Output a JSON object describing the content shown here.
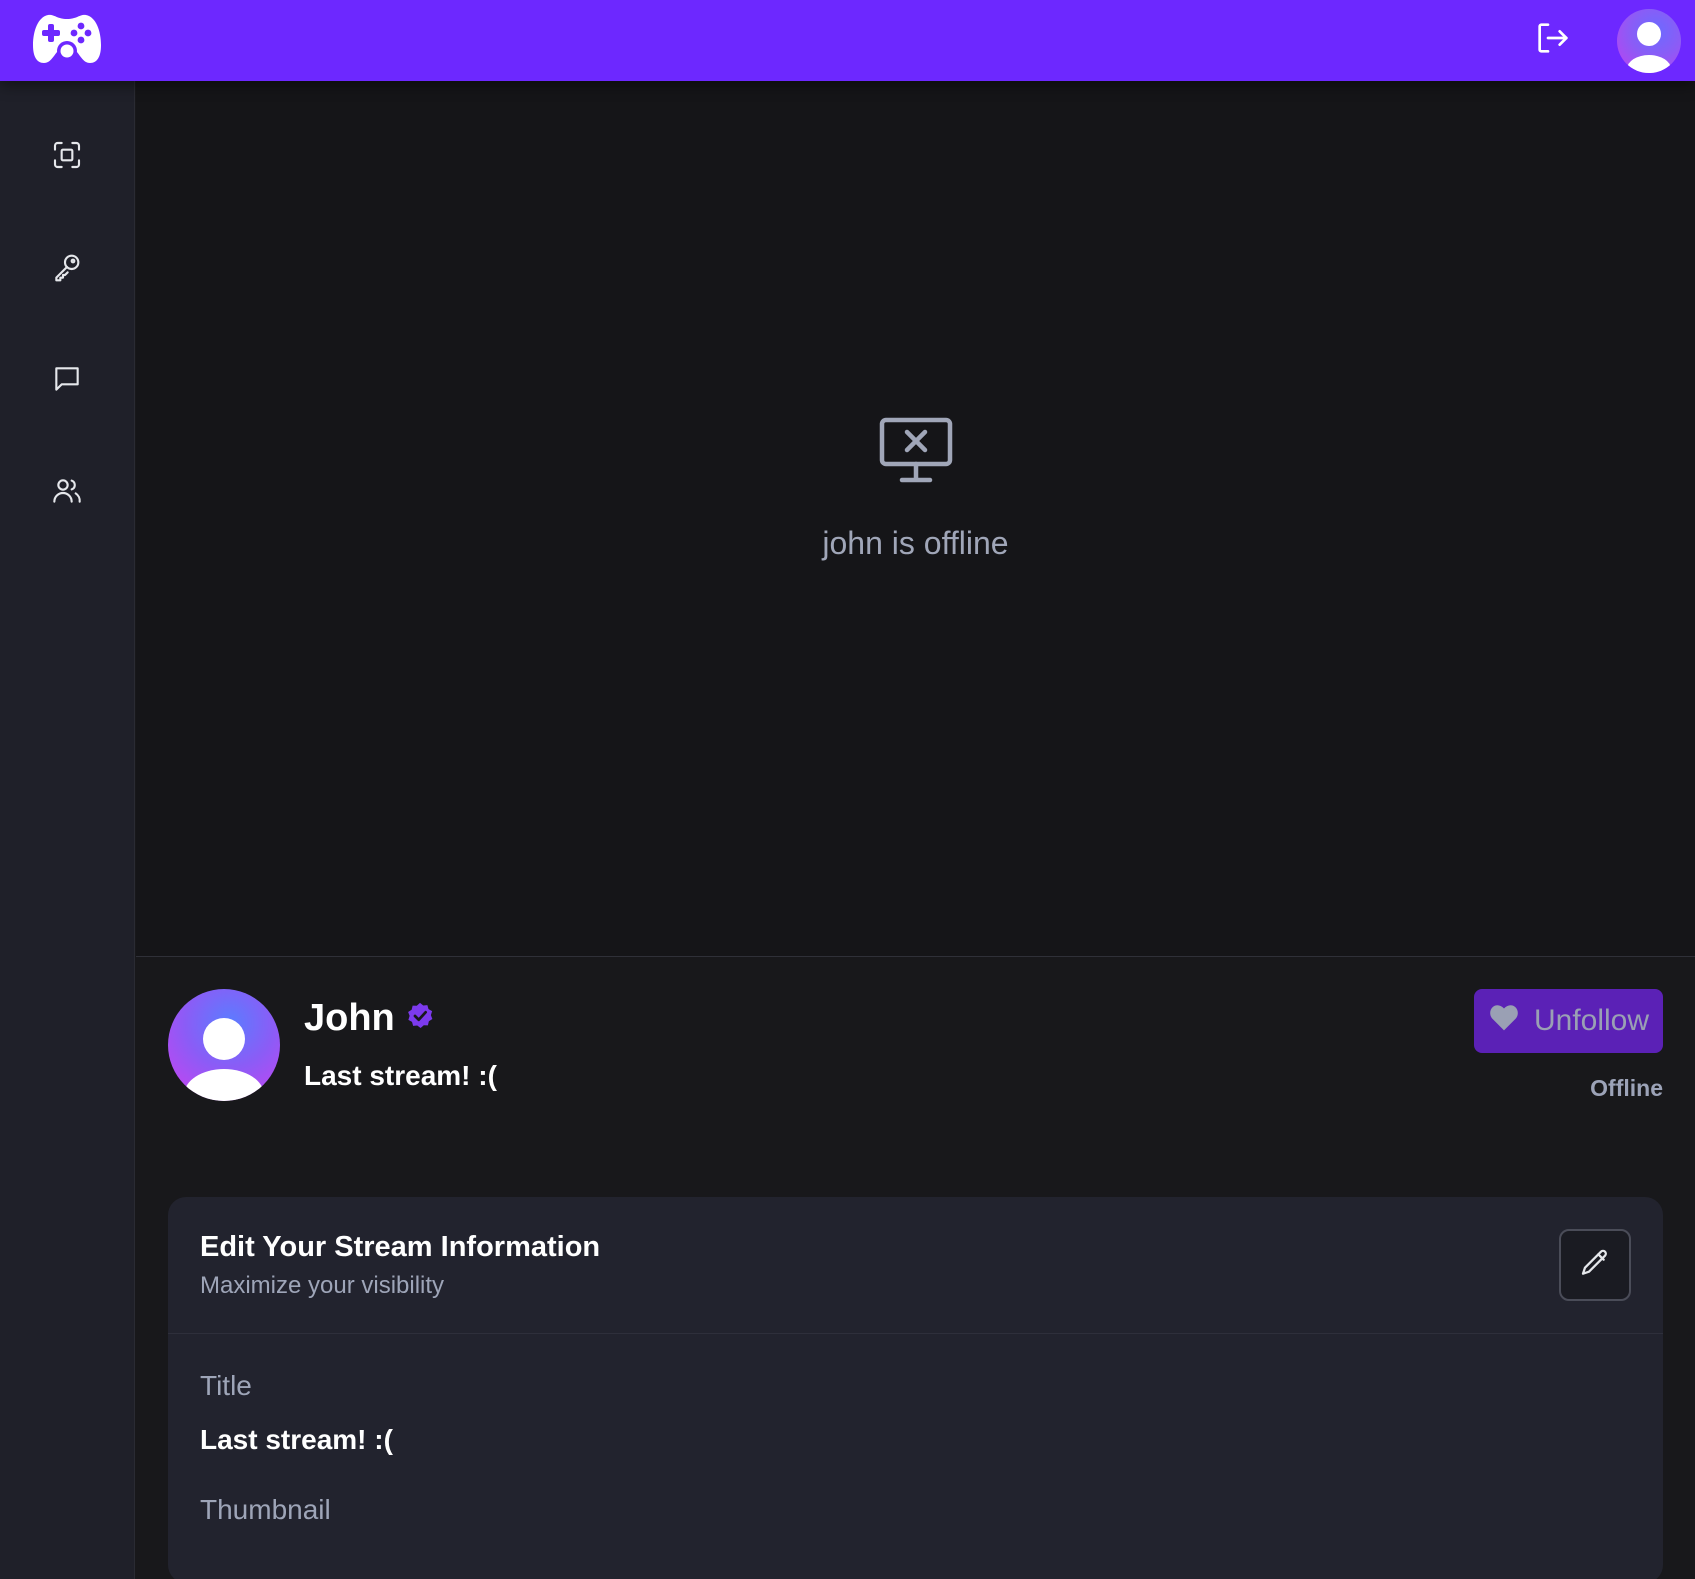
{
  "colors": {
    "accent": "#6d28ff",
    "sidebar_bg": "#1f2029",
    "main_bg": "#18181b",
    "card_bg": "#22232e",
    "unfollow_bg": "#5b21b6",
    "verified": "#7c3aed"
  },
  "topbar": {
    "logo_icon": "gamepad-icon",
    "logout_icon": "logout-icon",
    "avatar_icon": "user-icon"
  },
  "sidebar": {
    "items": [
      {
        "icon": "scan-icon"
      },
      {
        "icon": "key-icon"
      },
      {
        "icon": "chat-icon"
      },
      {
        "icon": "users-icon"
      }
    ]
  },
  "player": {
    "offline_icon": "monitor-x-icon",
    "offline_text": "john is offline"
  },
  "channel": {
    "name": "John",
    "verified_icon": "verified-badge-icon",
    "stream_title": "Last stream! :(",
    "follow_button_label": "Unfollow",
    "follow_button_icon": "heart-icon",
    "status": "Offline"
  },
  "edit_card": {
    "title": "Edit Your Stream Information",
    "subtitle": "Maximize your visibility",
    "edit_icon": "pencil-icon",
    "fields": {
      "title_label": "Title",
      "title_value": "Last stream! :(",
      "thumbnail_label": "Thumbnail"
    }
  }
}
